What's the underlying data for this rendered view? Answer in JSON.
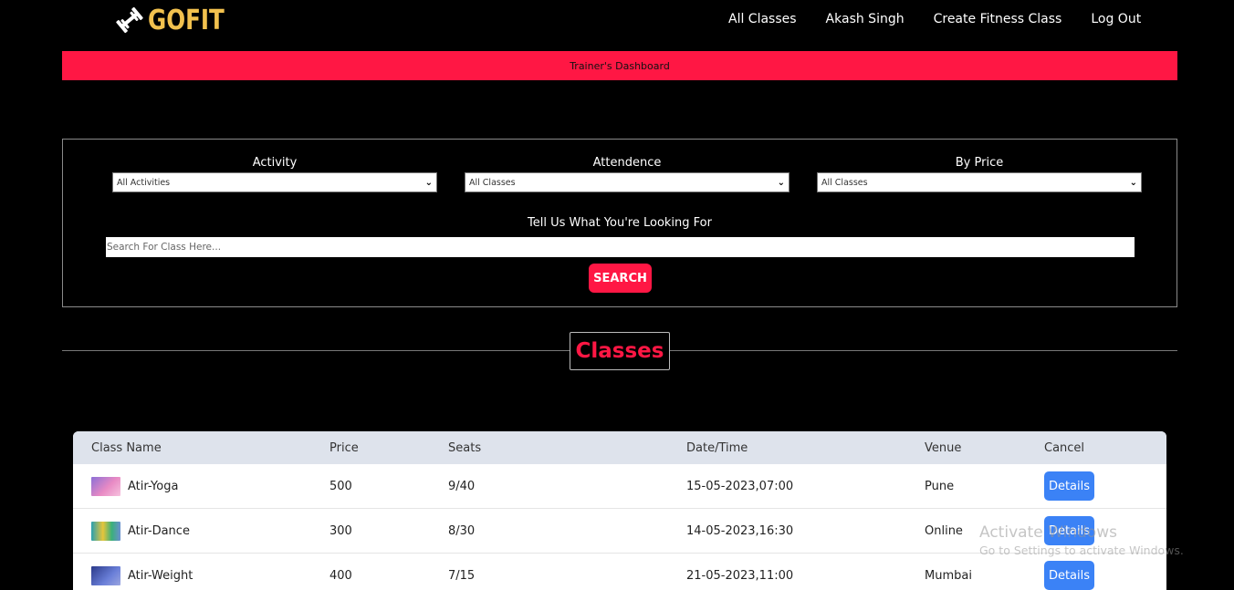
{
  "header": {
    "logo_text": "GOFIT",
    "logo_icon": "dumbbell-icon",
    "nav": [
      {
        "label": "All Classes"
      },
      {
        "label": "Akash Singh"
      },
      {
        "label": "Create Fitness Class"
      },
      {
        "label": "Log Out"
      }
    ]
  },
  "dashboard_bar": {
    "label": "Trainer's Dashboard"
  },
  "filters": {
    "activity": {
      "label": "Activity",
      "selected": "All Activities"
    },
    "attendence": {
      "label": "Attendence",
      "selected": "All Classes"
    },
    "price": {
      "label": "By Price",
      "selected": "All Classes"
    },
    "search_label": "Tell Us What You're Looking For",
    "search_placeholder": "Search For Class Here...",
    "search_button": "SEARCH"
  },
  "classes": {
    "title": "Classes",
    "columns": [
      "Class Name",
      "Price",
      "Seats",
      "Date/Time",
      "Venue",
      "Cancel"
    ],
    "rows": [
      {
        "name": "Atir-Yoga",
        "price": "500",
        "seats": "9/40",
        "datetime": "15-05-2023,07:00",
        "venue": "Pune",
        "action": "Details"
      },
      {
        "name": "Atir-Dance",
        "price": "300",
        "seats": "8/30",
        "datetime": "14-05-2023,16:30",
        "venue": "Online",
        "action": "Details"
      },
      {
        "name": "Atir-Weight",
        "price": "400",
        "seats": "7/15",
        "datetime": "21-05-2023,11:00",
        "venue": "Mumbai",
        "action": "Details"
      }
    ]
  },
  "watermark": {
    "line1": "Activate Windows",
    "line2": "Go to Settings to activate Windows."
  },
  "colors": {
    "accent": "#ff1744",
    "logo": "#f2c14e",
    "button_blue": "#3b82f6",
    "table_header": "#dee3ec"
  }
}
